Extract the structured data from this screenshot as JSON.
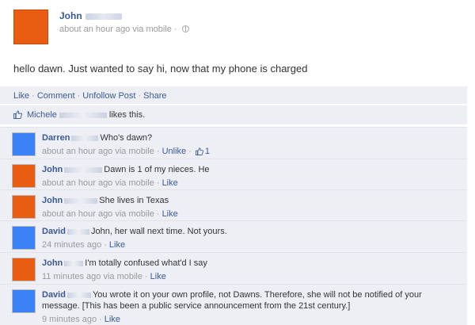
{
  "post": {
    "author": "John",
    "meta": "about an hour ago via mobile",
    "meta_sep": "·",
    "text": "hello dawn. Just wanted to say hi, now that my phone is charged",
    "avatar_color": "#e85d12"
  },
  "actions": {
    "like": "Like",
    "comment": "Comment",
    "unfollow": "Unfollow Post",
    "share": "Share",
    "sep": "·"
  },
  "likes": {
    "name": "Michele",
    "suffix": "likes this."
  },
  "comments": [
    {
      "author": "Darren",
      "text": "Who's dawn?",
      "time": "about an hour ago via mobile",
      "action": "Unlike",
      "like_count": "1",
      "avatar_color": "#3b82f6"
    },
    {
      "author": "John",
      "text": "Dawn is 1 of my nieces. He",
      "time": "about an hour ago via mobile",
      "action": "Like",
      "avatar_color": "#e85d12"
    },
    {
      "author": "John",
      "text": "She lives in Texas",
      "time": "about an hour ago via mobile",
      "action": "Like",
      "avatar_color": "#e85d12"
    },
    {
      "author": "David",
      "text": "John, her wall next time. Not yours.",
      "time": "24 minutes ago",
      "action": "Like",
      "avatar_color": "#3b82f6"
    },
    {
      "author": "John",
      "text": "I'm totally confused what'd I say",
      "time": "11 minutes ago via mobile",
      "action": "Like",
      "avatar_color": "#e85d12"
    },
    {
      "author": "David",
      "text": "You wrote it on your own profile, not Dawns. Therefore, she will not be notified of your message. [This has been a public service announcement from the 21st century.]",
      "time": "9 minutes ago",
      "action": "Like",
      "avatar_color": "#3b82f6"
    }
  ],
  "icons": {
    "globe": "globe-icon",
    "thumb": "thumbs-up-icon"
  },
  "colors": {
    "link": "#3b5998",
    "panel_bg": "#edeff4",
    "meta_text": "#999999"
  }
}
